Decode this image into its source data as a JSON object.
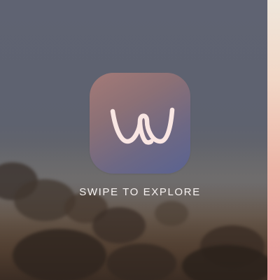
{
  "onboarding": {
    "prompt_text": "SWIPE TO EXPLORE",
    "app_logo_icon": "w-logo-icon",
    "accent_color": "#f9e6e3",
    "background_image": "foggy-landscape-image",
    "next_page_preview_colors": [
      "#f0e7dc",
      "#f3d8c8",
      "#f0b7aa",
      "#ee9ea3"
    ]
  }
}
